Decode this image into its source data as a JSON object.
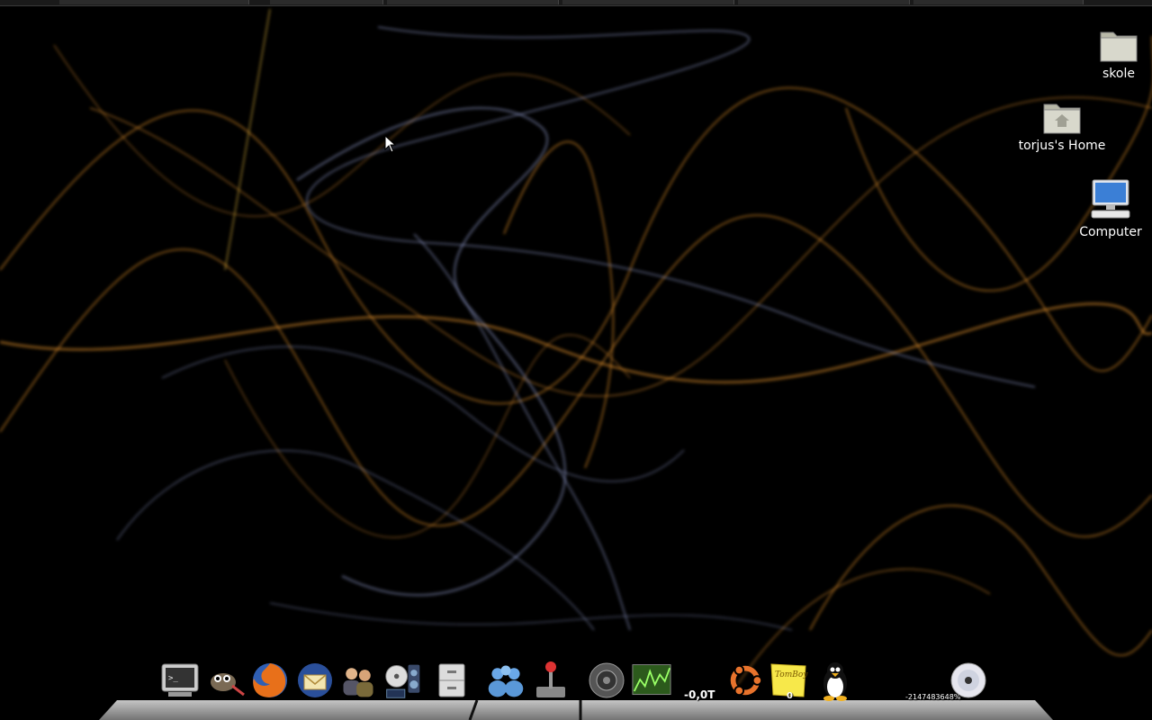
{
  "desktop_icons": {
    "skole": {
      "label": "skole",
      "icon": "folder-icon"
    },
    "home": {
      "label": "torjus's Home",
      "icon": "home-folder-icon"
    },
    "computer": {
      "label": "Computer",
      "icon": "computer-icon"
    }
  },
  "dock": {
    "items": [
      {
        "name": "terminal",
        "icon": "terminal-icon"
      },
      {
        "name": "gimp",
        "icon": "gimp-icon"
      },
      {
        "name": "firefox",
        "icon": "firefox-icon"
      },
      {
        "name": "thunderbird",
        "icon": "thunderbird-icon"
      },
      {
        "name": "contacts",
        "icon": "contacts-icon"
      },
      {
        "name": "media-player",
        "icon": "media-player-icon"
      },
      {
        "name": "file-cabinet",
        "icon": "file-cabinet-icon"
      },
      {
        "name": "messenger",
        "icon": "messenger-icon"
      },
      {
        "name": "joystick",
        "icon": "joystick-icon"
      },
      {
        "name": "speaker",
        "icon": "speaker-icon"
      },
      {
        "name": "system-monitor",
        "icon": "system-monitor-icon"
      },
      {
        "name": "ubuntu",
        "icon": "ubuntu-icon"
      },
      {
        "name": "tomboy",
        "icon": "tomboy-notes-icon"
      },
      {
        "name": "tux",
        "icon": "tux-penguin-icon"
      },
      {
        "name": "cd",
        "icon": "cd-disc-icon"
      }
    ],
    "temp_text": "-0,0T",
    "tomboy_label": "TomBoy",
    "tomboy_count": "0",
    "cpu_text": "-2147483648%"
  },
  "colors": {
    "wallpaper_bg": "#000000",
    "swirl_orange": "#d98a2b",
    "swirl_blue": "#9aa3d8"
  }
}
